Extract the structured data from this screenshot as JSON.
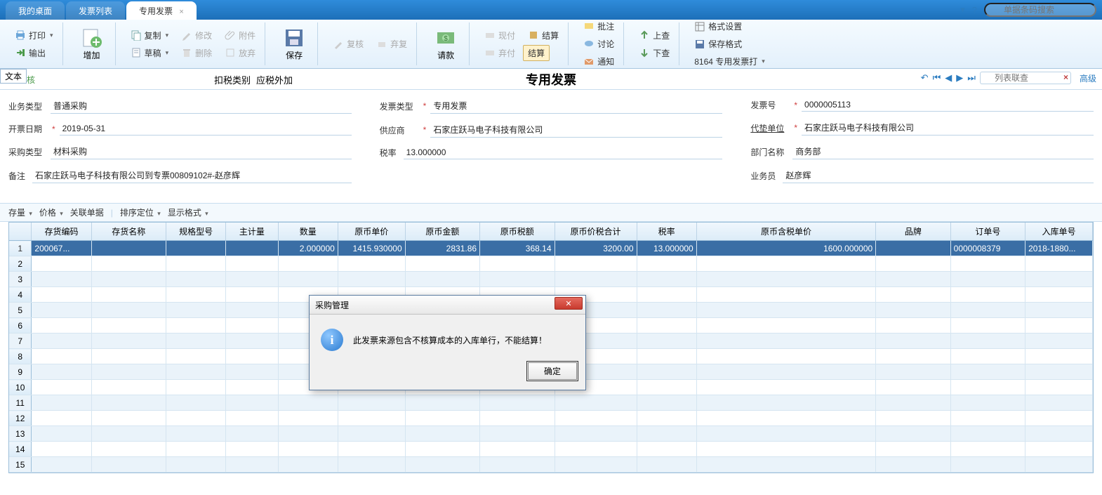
{
  "tabs": {
    "desktop": "我的桌面",
    "list": "发票列表",
    "active": "专用发票"
  },
  "search_placeholder": "单据条码搜索",
  "ribbon": {
    "print": "打印",
    "export": "输出",
    "add": "增加",
    "copy": "复制",
    "draft": "草稿",
    "modify": "修改",
    "delete": "删除",
    "attach": "附件",
    "freeze": "放弃",
    "save": "保存",
    "review": "复核",
    "abandon": "弃复",
    "request": "请款",
    "cash": "现付",
    "pay": "弃付",
    "settle": "结算",
    "settle2": "结算",
    "annotate": "批注",
    "discuss": "讨论",
    "notify": "通知",
    "prev": "上查",
    "next": "下查",
    "fmt": "格式设置",
    "savefmt": "保存格式",
    "tpl": "8164 专用发票打"
  },
  "subhdr": {
    "textbox": "文本",
    "status_suffix": "核",
    "tax_label": "扣税类别",
    "tax_val": "应税外加",
    "title": "专用发票",
    "list_search": "列表联查",
    "advanced": "高级"
  },
  "form": {
    "biz_type_l": "业务类型",
    "biz_type_v": "普通采购",
    "date_l": "开票日期",
    "date_v": "2019-05-31",
    "purchase_l": "采购类型",
    "purchase_v": "材料采购",
    "remark_l": "备注",
    "remark_v": "石家庄跃马电子科技有限公司到专票00809102#-赵彦辉",
    "inv_type_l": "发票类型",
    "inv_type_v": "专用发票",
    "supplier_l": "供应商",
    "supplier_v": "石家庄跃马电子科技有限公司",
    "rate_l": "税率",
    "rate_v": "13.000000",
    "inv_no_l": "发票号",
    "inv_no_v": "0000005113",
    "advance_l": "代垫单位",
    "advance_v": "石家庄跃马电子科技有限公司",
    "dept_l": "部门名称",
    "dept_v": "商务部",
    "clerk_l": "业务员",
    "clerk_v": "赵彦辉"
  },
  "mini": {
    "stock": "存量",
    "price": "价格",
    "rel": "关联单据",
    "sort": "排序定位",
    "disp": "显示格式"
  },
  "columns": [
    "存货编码",
    "存货名称",
    "规格型号",
    "主计量",
    "数量",
    "原币单价",
    "原币金额",
    "原币税额",
    "原币价税合计",
    "税率",
    "原币含税单价",
    "品牌",
    "订单号",
    "入库单号"
  ],
  "rows": [
    {
      "code": "200067...",
      "qty": "2.000000",
      "price": "1415.930000",
      "amount": "2831.86",
      "tax": "368.14",
      "total": "3200.00",
      "rate": "13.000000",
      "taxprice": "1600.000000",
      "order": "0000008379",
      "inbound": "2018-1880..."
    }
  ],
  "modal": {
    "title": "采购管理",
    "msg": "此发票来源包含不核算成本的入库单行，不能结算！",
    "ok": "确定"
  }
}
